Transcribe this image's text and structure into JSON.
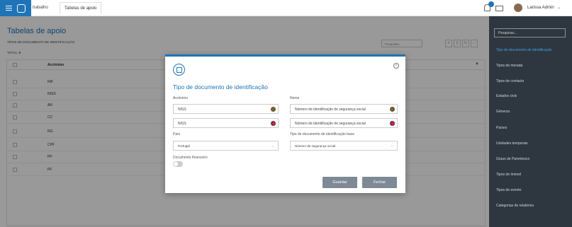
{
  "topbar": {
    "breadcrumb_partial": "trabalho",
    "active_tab": "Tabelas de apoio",
    "user_name": "Larissa Admin"
  },
  "page": {
    "title": "Tabelas de apoio",
    "subtitle": "TIPOS DE DOCUMENTO DE IDENTIFICAÇÃO",
    "total_label": "TOTAL:",
    "total_value": "8",
    "search_placeholder": "Pesquisar...",
    "column_header": "Acrónimo",
    "rows": [
      "NIF",
      "NISS",
      "AR",
      "CC",
      "RG",
      "CPF",
      "PP",
      "PF"
    ]
  },
  "sidebar": {
    "search_placeholder": "Pesquisar...",
    "items": [
      "Tipo de documento de identificação",
      "Tipos de morada",
      "Tipos de contacto",
      "Estados civis",
      "Géneros",
      "Países",
      "Unidades temporais",
      "Graus de Parentesco",
      "Tipos de Imóvel",
      "Tipos de evento",
      "Categorias de relatórios"
    ]
  },
  "modal": {
    "title": "Tipo de documento de identificação",
    "acronimo_label": "Acrónimo",
    "acronimo_pt": "NISS",
    "acronimo_en": "NISS",
    "nome_label": "Nome",
    "nome_pt": "Número de identificação de segurança social",
    "nome_en": "Número de identificação de segurança social",
    "pais_label": "País",
    "pais_value": "Portugal",
    "tipo_base_label": "Tipo de documento de identificação base",
    "tipo_base_value": "Número de segurança social",
    "financeiro_label": "Documento financeiro",
    "save_label": "Guardar",
    "close_label": "Fechar"
  },
  "colors": {
    "accent": "#1f73b7",
    "sidebar_bg": "#2e3740",
    "button_gray": "#7d8a96"
  }
}
